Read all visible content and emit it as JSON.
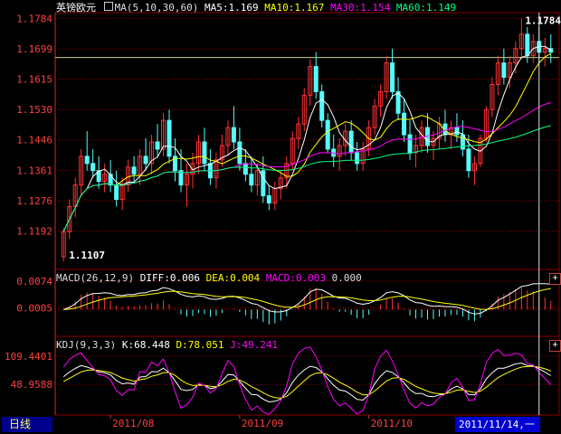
{
  "main_legend": {
    "title": "英镑欧元",
    "ma_params": "MA(5,10,30,60)",
    "ma5": "MA5:1.169",
    "ma10": "MA10:1.167",
    "ma30": "MA30:1.154",
    "ma60": "MA60:1.149"
  },
  "macd_legend": {
    "params": "MACD(26,12,9)",
    "diff": "DIFF:0.006",
    "dea": "DEA:0.004",
    "macd": "MACD:0.003",
    "extra": "0.000"
  },
  "kdj_legend": {
    "params": "KDJ(9,3,3)",
    "k": "K:68.448",
    "d": "D:78.051",
    "j": "J:49.241"
  },
  "price_axis": [
    "1.1784",
    "1.1699",
    "1.1615",
    "1.1530",
    "1.1446",
    "1.1361",
    "1.1276",
    "1.1192"
  ],
  "macd_axis": [
    "0.0074",
    "0.0005"
  ],
  "kdj_axis": [
    "109.4401",
    "48.9588"
  ],
  "markers": {
    "high": "1.1784",
    "low": "1.1107"
  },
  "months": [
    "2011/08",
    "2011/09",
    "2011/10"
  ],
  "period_tab": "日线",
  "cursor_date": "2011/11/14,一",
  "colors": {
    "up": "#ff3232",
    "down": "#54fcfc",
    "ma5": "#ffffff",
    "ma10": "#ffff00",
    "ma30": "#ff00ff",
    "ma60": "#00ff80",
    "grid": "#8b0000"
  },
  "chart_data": {
    "type": "candlestick",
    "symbol": "英镑欧元",
    "ylim": [
      1.11,
      1.179
    ],
    "candles": [
      [
        1.112,
        1.12,
        1.1107,
        1.119
      ],
      [
        1.119,
        1.128,
        1.117,
        1.126
      ],
      [
        1.126,
        1.134,
        1.123,
        1.132
      ],
      [
        1.132,
        1.142,
        1.129,
        1.14
      ],
      [
        1.14,
        1.147,
        1.136,
        1.138
      ],
      [
        1.138,
        1.142,
        1.134,
        1.136
      ],
      [
        1.136,
        1.14,
        1.131,
        1.133
      ],
      [
        1.133,
        1.138,
        1.13,
        1.135
      ],
      [
        1.135,
        1.139,
        1.13,
        1.132
      ],
      [
        1.132,
        1.136,
        1.126,
        1.128
      ],
      [
        1.128,
        1.134,
        1.125,
        1.132
      ],
      [
        1.132,
        1.139,
        1.13,
        1.137
      ],
      [
        1.137,
        1.14,
        1.133,
        1.135
      ],
      [
        1.135,
        1.142,
        1.132,
        1.14
      ],
      [
        1.14,
        1.145,
        1.136,
        1.138
      ],
      [
        1.138,
        1.146,
        1.135,
        1.144
      ],
      [
        1.144,
        1.149,
        1.14,
        1.142
      ],
      [
        1.142,
        1.152,
        1.14,
        1.15
      ],
      [
        1.15,
        1.153,
        1.138,
        1.14
      ],
      [
        1.14,
        1.145,
        1.133,
        1.136
      ],
      [
        1.136,
        1.142,
        1.13,
        1.132
      ],
      [
        1.132,
        1.138,
        1.126,
        1.135
      ],
      [
        1.135,
        1.141,
        1.131,
        1.138
      ],
      [
        1.138,
        1.146,
        1.135,
        1.144
      ],
      [
        1.144,
        1.148,
        1.136,
        1.138
      ],
      [
        1.138,
        1.142,
        1.132,
        1.134
      ],
      [
        1.134,
        1.141,
        1.131,
        1.139
      ],
      [
        1.139,
        1.146,
        1.137,
        1.143
      ],
      [
        1.143,
        1.15,
        1.14,
        1.148
      ],
      [
        1.148,
        1.154,
        1.142,
        1.144
      ],
      [
        1.144,
        1.148,
        1.136,
        1.138
      ],
      [
        1.138,
        1.142,
        1.133,
        1.135
      ],
      [
        1.135,
        1.14,
        1.13,
        1.132
      ],
      [
        1.132,
        1.138,
        1.129,
        1.136
      ],
      [
        1.136,
        1.14,
        1.127,
        1.129
      ],
      [
        1.129,
        1.132,
        1.125,
        1.127
      ],
      [
        1.127,
        1.133,
        1.125,
        1.131
      ],
      [
        1.131,
        1.136,
        1.128,
        1.134
      ],
      [
        1.134,
        1.14,
        1.131,
        1.138
      ],
      [
        1.138,
        1.147,
        1.136,
        1.145
      ],
      [
        1.145,
        1.151,
        1.142,
        1.149
      ],
      [
        1.149,
        1.159,
        1.147,
        1.157
      ],
      [
        1.157,
        1.167,
        1.154,
        1.165
      ],
      [
        1.165,
        1.169,
        1.156,
        1.158
      ],
      [
        1.158,
        1.16,
        1.148,
        1.15
      ],
      [
        1.15,
        1.152,
        1.141,
        1.142
      ],
      [
        1.142,
        1.146,
        1.137,
        1.14
      ],
      [
        1.14,
        1.145,
        1.136,
        1.143
      ],
      [
        1.143,
        1.149,
        1.14,
        1.147
      ],
      [
        1.147,
        1.15,
        1.139,
        1.141
      ],
      [
        1.141,
        1.144,
        1.136,
        1.138
      ],
      [
        1.138,
        1.144,
        1.136,
        1.142
      ],
      [
        1.142,
        1.15,
        1.14,
        1.148
      ],
      [
        1.148,
        1.156,
        1.146,
        1.154
      ],
      [
        1.154,
        1.16,
        1.151,
        1.158
      ],
      [
        1.158,
        1.168,
        1.156,
        1.166
      ],
      [
        1.166,
        1.17,
        1.156,
        1.158
      ],
      [
        1.158,
        1.162,
        1.15,
        1.152
      ],
      [
        1.152,
        1.156,
        1.144,
        1.146
      ],
      [
        1.146,
        1.15,
        1.139,
        1.141
      ],
      [
        1.141,
        1.146,
        1.137,
        1.143
      ],
      [
        1.143,
        1.15,
        1.141,
        1.148
      ],
      [
        1.148,
        1.152,
        1.141,
        1.143
      ],
      [
        1.143,
        1.147,
        1.139,
        1.145
      ],
      [
        1.145,
        1.151,
        1.142,
        1.149
      ],
      [
        1.149,
        1.153,
        1.144,
        1.146
      ],
      [
        1.146,
        1.15,
        1.142,
        1.148
      ],
      [
        1.148,
        1.152,
        1.144,
        1.146
      ],
      [
        1.146,
        1.15,
        1.14,
        1.142
      ],
      [
        1.142,
        1.146,
        1.134,
        1.136
      ],
      [
        1.136,
        1.14,
        1.132,
        1.138
      ],
      [
        1.138,
        1.146,
        1.137,
        1.145
      ],
      [
        1.145,
        1.154,
        1.144,
        1.153
      ],
      [
        1.153,
        1.162,
        1.151,
        1.16
      ],
      [
        1.16,
        1.168,
        1.157,
        1.166
      ],
      [
        1.166,
        1.17,
        1.16,
        1.162
      ],
      [
        1.162,
        1.168,
        1.159,
        1.166
      ],
      [
        1.166,
        1.172,
        1.163,
        1.17
      ],
      [
        1.17,
        1.1784,
        1.167,
        1.174
      ],
      [
        1.174,
        1.176,
        1.166,
        1.168
      ],
      [
        1.168,
        1.174,
        1.166,
        1.172
      ],
      [
        1.172,
        1.176,
        1.166,
        1.169
      ],
      [
        1.169,
        1.173,
        1.165,
        1.17
      ],
      [
        1.17,
        1.174,
        1.166,
        1.169
      ]
    ],
    "ma_note": "MA5/MA10/MA30/MA60 lines computed from candles",
    "kdj_ylim": [
      0,
      120
    ],
    "macd_ylim": [
      -0.006,
      0.009
    ]
  }
}
